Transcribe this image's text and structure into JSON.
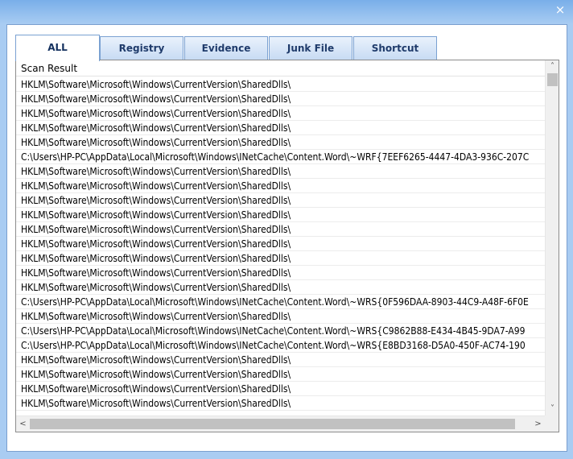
{
  "window": {
    "close_glyph": "×"
  },
  "tabs": [
    {
      "label": "ALL"
    },
    {
      "label": "Registry"
    },
    {
      "label": "Evidence"
    },
    {
      "label": "Junk File"
    },
    {
      "label": "Shortcut"
    }
  ],
  "active_tab": "ALL",
  "list": {
    "header": "Scan Result",
    "rows": [
      "HKLM\\Software\\Microsoft\\Windows\\CurrentVersion\\SharedDlls\\",
      "HKLM\\Software\\Microsoft\\Windows\\CurrentVersion\\SharedDlls\\",
      "HKLM\\Software\\Microsoft\\Windows\\CurrentVersion\\SharedDlls\\",
      "HKLM\\Software\\Microsoft\\Windows\\CurrentVersion\\SharedDlls\\",
      "HKLM\\Software\\Microsoft\\Windows\\CurrentVersion\\SharedDlls\\",
      "C:\\Users\\HP-PC\\AppData\\Local\\Microsoft\\Windows\\INetCache\\Content.Word\\~WRF{7EEF6265-4447-4DA3-936C-207C",
      "HKLM\\Software\\Microsoft\\Windows\\CurrentVersion\\SharedDlls\\",
      "HKLM\\Software\\Microsoft\\Windows\\CurrentVersion\\SharedDlls\\",
      "HKLM\\Software\\Microsoft\\Windows\\CurrentVersion\\SharedDlls\\",
      "HKLM\\Software\\Microsoft\\Windows\\CurrentVersion\\SharedDlls\\",
      "HKLM\\Software\\Microsoft\\Windows\\CurrentVersion\\SharedDlls\\",
      "HKLM\\Software\\Microsoft\\Windows\\CurrentVersion\\SharedDlls\\",
      "HKLM\\Software\\Microsoft\\Windows\\CurrentVersion\\SharedDlls\\",
      "HKLM\\Software\\Microsoft\\Windows\\CurrentVersion\\SharedDlls\\",
      "HKLM\\Software\\Microsoft\\Windows\\CurrentVersion\\SharedDlls\\",
      "C:\\Users\\HP-PC\\AppData\\Local\\Microsoft\\Windows\\INetCache\\Content.Word\\~WRS{0F596DAA-8903-44C9-A48F-6F0E",
      "HKLM\\Software\\Microsoft\\Windows\\CurrentVersion\\SharedDlls\\",
      "C:\\Users\\HP-PC\\AppData\\Local\\Microsoft\\Windows\\INetCache\\Content.Word\\~WRS{C9862B88-E434-4B45-9DA7-A99",
      "C:\\Users\\HP-PC\\AppData\\Local\\Microsoft\\Windows\\INetCache\\Content.Word\\~WRS{E8BD3168-D5A0-450F-AC74-190",
      "HKLM\\Software\\Microsoft\\Windows\\CurrentVersion\\SharedDlls\\",
      "HKLM\\Software\\Microsoft\\Windows\\CurrentVersion\\SharedDlls\\",
      "HKLM\\Software\\Microsoft\\Windows\\CurrentVersion\\SharedDlls\\",
      "HKLM\\Software\\Microsoft\\Windows\\CurrentVersion\\SharedDlls\\"
    ]
  },
  "scrollbars": {
    "up_glyph": "˄",
    "down_glyph": "˅",
    "left_glyph": "<",
    "right_glyph": ">"
  },
  "colors": {
    "window_gradient_top": "#79aee9",
    "window_body": "#a9ccf2",
    "tab_text": "#1f3b6b",
    "tab_border": "#7aa1d2"
  }
}
